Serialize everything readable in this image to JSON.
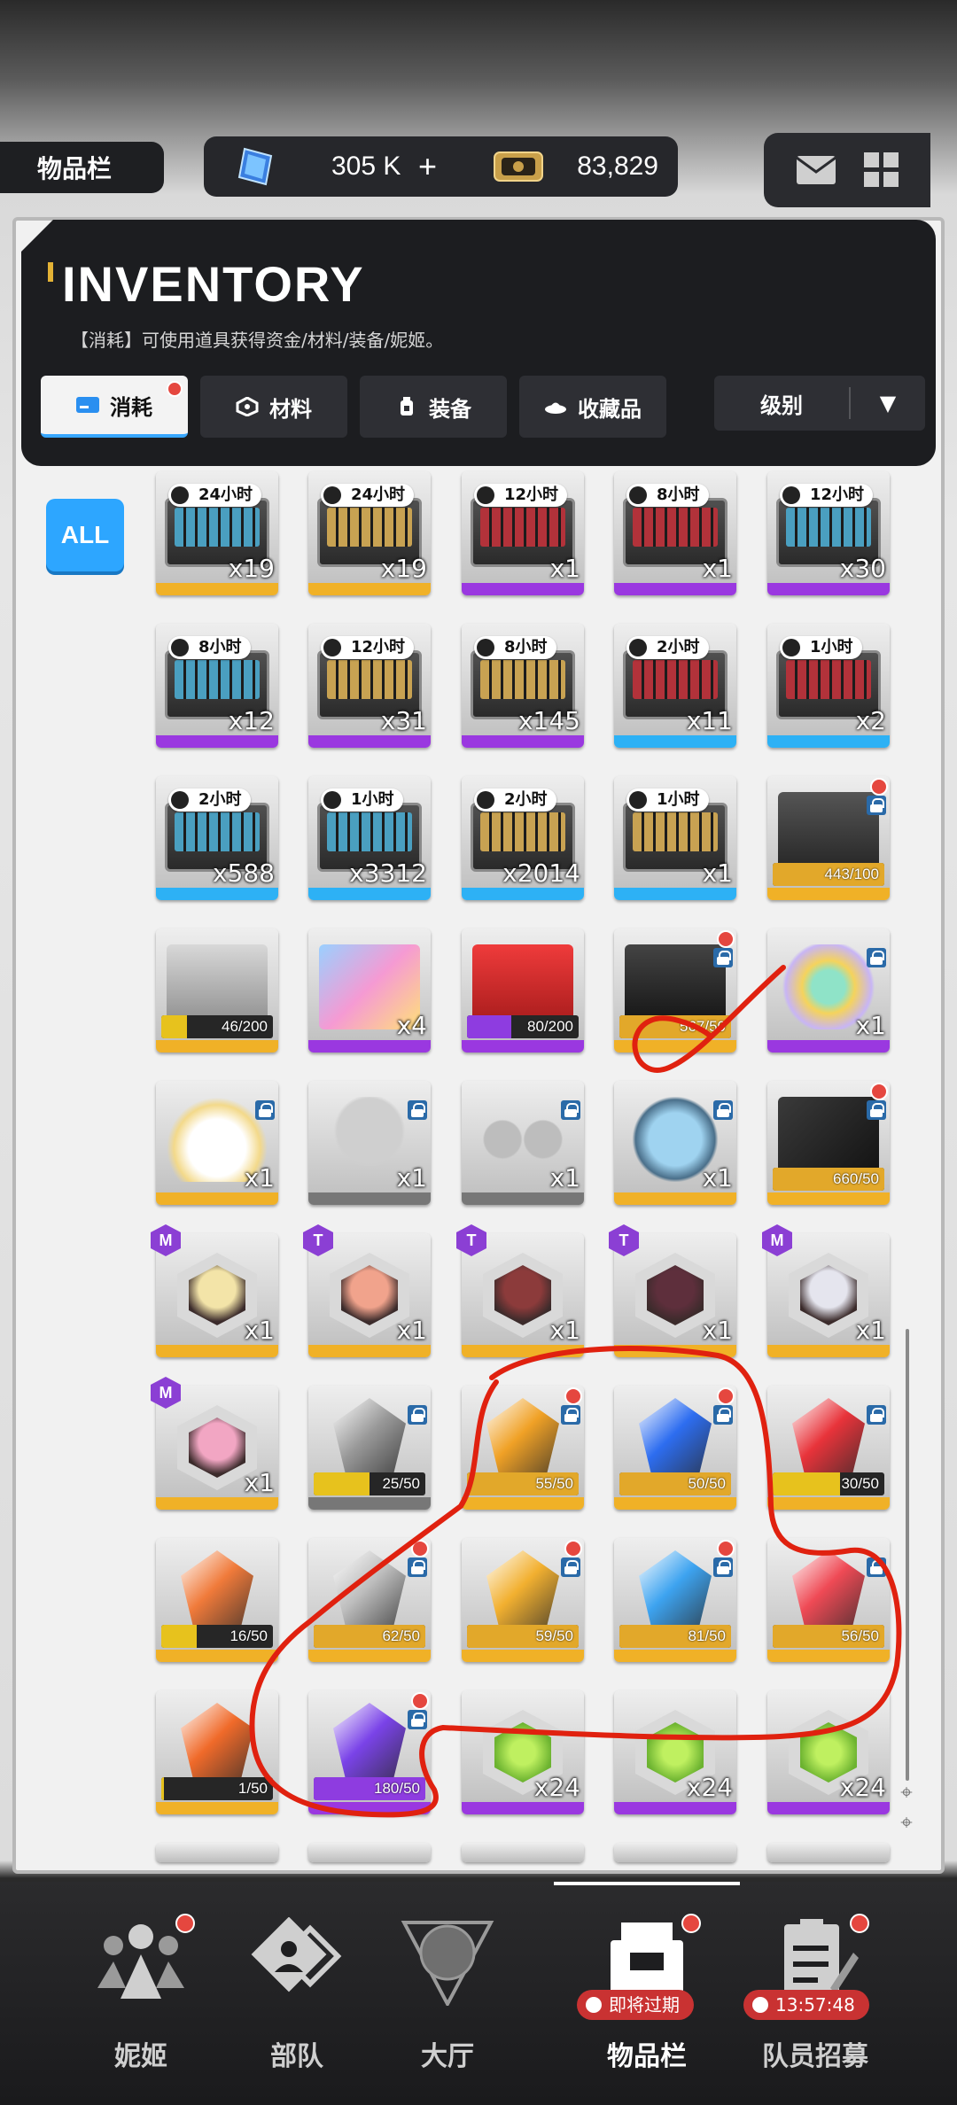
{
  "header": {
    "page_tag": "物品栏",
    "gems": "305 K",
    "gems_plus": "+",
    "credits": "83,829"
  },
  "panel": {
    "title": "INVENTORY",
    "subtitle": "【消耗】可使用道具获得资金/材料/装备/妮姬。",
    "tabs": [
      {
        "label": "消耗",
        "icon": "consumable-icon"
      },
      {
        "label": "材料",
        "icon": "material-icon"
      },
      {
        "label": "装备",
        "icon": "equipment-icon"
      },
      {
        "label": "收藏品",
        "icon": "collection-icon"
      }
    ],
    "sort_label": "级别",
    "sort_caret": "▼"
  },
  "filter_all": "ALL",
  "colors": {
    "gold": "#f0b127",
    "purple": "#9a38e0",
    "blue": "#2db1f5",
    "red_dot": "#e5473f",
    "annotation": "#e0210f"
  },
  "rows": [
    [
      {
        "timer": "24小时",
        "qty": "x19",
        "rarity": "gold",
        "liner": "#4a9fc0"
      },
      {
        "timer": "24小时",
        "qty": "x19",
        "rarity": "gold",
        "liner": "#c8a252"
      },
      {
        "timer": "12小时",
        "qty": "x1",
        "rarity": "purple",
        "liner": "#b2323a"
      },
      {
        "timer": "8小时",
        "qty": "x1",
        "rarity": "purple",
        "liner": "#b2323a"
      },
      {
        "timer": "12小时",
        "qty": "x30",
        "rarity": "purple",
        "liner": "#4a9fc0"
      }
    ],
    [
      {
        "timer": "8小时",
        "qty": "x12",
        "rarity": "purple",
        "liner": "#4a9fc0"
      },
      {
        "timer": "12小时",
        "qty": "x31",
        "rarity": "purple",
        "liner": "#c8a252"
      },
      {
        "timer": "8小时",
        "qty": "x145",
        "rarity": "purple",
        "liner": "#c8a252"
      },
      {
        "timer": "2小时",
        "qty": "x11",
        "rarity": "blue",
        "liner": "#b2323a"
      },
      {
        "timer": "1小时",
        "qty": "x2",
        "rarity": "blue",
        "liner": "#b2323a"
      }
    ],
    [
      {
        "timer": "2小时",
        "qty": "x588",
        "rarity": "blue",
        "liner": "#4a9fc0"
      },
      {
        "timer": "1小时",
        "qty": "x3312",
        "rarity": "blue",
        "liner": "#4a9fc0"
      },
      {
        "timer": "2小时",
        "qty": "x2014",
        "rarity": "blue",
        "liner": "#c8a252"
      },
      {
        "timer": "1小时",
        "qty": "x1",
        "rarity": "blue",
        "liner": "#c8a252"
      },
      {
        "bar": "443/100",
        "fill": 1.0,
        "fill_color": "#e2a82a",
        "lock": true,
        "dot": true,
        "rarity": "gold",
        "art": "chest-icon"
      }
    ],
    [
      {
        "bar": "46/200",
        "fill": 0.23,
        "fill_color": "#e7c21d",
        "rarity": "gold",
        "art": "crate-icon"
      },
      {
        "qty": "x4",
        "rarity": "purple",
        "art": "gift-box-icon"
      },
      {
        "bar": "80/200",
        "fill": 0.4,
        "fill_color": "#8e3ce0",
        "rarity": "purple",
        "art": "lucky-box-icon"
      },
      {
        "bar": "567/50",
        "fill": 1.0,
        "fill_color": "#e2a82a",
        "lock": true,
        "dot": true,
        "rarity": "gold",
        "art": "black-box-icon"
      },
      {
        "qty": "x1",
        "lock": true,
        "rarity": "purple",
        "art": "bouquet-icon"
      }
    ],
    [
      {
        "qty": "x1",
        "lock": true,
        "rarity": "gold",
        "art": "cake-icon"
      },
      {
        "qty": "x1",
        "lock": true,
        "rarity": "gray",
        "art": "briefs-icon"
      },
      {
        "qty": "x1",
        "lock": true,
        "rarity": "gray",
        "art": "bra-icon"
      },
      {
        "qty": "x1",
        "lock": true,
        "rarity": "gold",
        "art": "robot-head-icon"
      },
      {
        "bar": "660/50",
        "fill": 1.0,
        "fill_color": "#e2a82a",
        "lock": true,
        "dot": true,
        "rarity": "gold",
        "art": "dark-box-icon"
      }
    ],
    [
      {
        "qty": "x1",
        "badge": "M",
        "rarity": "gold",
        "face": "#f3e4a8"
      },
      {
        "qty": "x1",
        "badge": "T",
        "rarity": "gold",
        "face": "#f1a38c"
      },
      {
        "qty": "x1",
        "badge": "T",
        "rarity": "gold",
        "face": "#8c3b3b"
      },
      {
        "qty": "x1",
        "badge": "T",
        "rarity": "gold",
        "face": "#5e2f3c"
      },
      {
        "qty": "x1",
        "badge": "M",
        "rarity": "gold",
        "face": "#e5e5ee"
      }
    ],
    [
      {
        "qty": "x1",
        "badge": "M",
        "rarity": "gold",
        "face": "#f2a6c3"
      },
      {
        "bar": "25/50",
        "fill": 0.5,
        "fill_color": "#e7c21d",
        "lock": true,
        "rarity": "gray",
        "crystal": "#9a9a9a"
      },
      {
        "bar": "55/50",
        "fill": 1.0,
        "fill_color": "#e2a82a",
        "lock": true,
        "dot": true,
        "rarity": "gold",
        "crystal": "#f0a126"
      },
      {
        "bar": "50/50",
        "fill": 1.0,
        "fill_color": "#e2a82a",
        "lock": true,
        "dot": true,
        "rarity": "gold",
        "crystal": "#2d6df0"
      },
      {
        "bar": "30/50",
        "fill": 0.6,
        "fill_color": "#e7c21d",
        "lock": true,
        "rarity": "gold",
        "crystal": "#e8333a"
      }
    ],
    [
      {
        "bar": "16/50",
        "fill": 0.32,
        "fill_color": "#e7c21d",
        "rarity": "gold",
        "crystal": "#f07a3a"
      },
      {
        "bar": "62/50",
        "fill": 1.0,
        "fill_color": "#e2a82a",
        "lock": true,
        "dot": true,
        "rarity": "gold",
        "crystal": "#bdbdbd"
      },
      {
        "bar": "59/50",
        "fill": 1.0,
        "fill_color": "#e2a82a",
        "lock": true,
        "dot": true,
        "rarity": "gold",
        "crystal": "#f2b030"
      },
      {
        "bar": "81/50",
        "fill": 1.0,
        "fill_color": "#e2a82a",
        "lock": true,
        "dot": true,
        "rarity": "gold",
        "crystal": "#3da3f0"
      },
      {
        "bar": "56/50",
        "fill": 1.0,
        "fill_color": "#e2a82a",
        "lock": true,
        "rarity": "gold",
        "crystal": "#ef4a55"
      }
    ],
    [
      {
        "bar": "1/50",
        "fill": 0.02,
        "fill_color": "#e7c21d",
        "rarity": "gold",
        "crystal": "#f06a2a"
      },
      {
        "bar": "180/50",
        "fill": 1.0,
        "fill_color": "#8e3ce0",
        "lock": true,
        "dot": true,
        "rarity": "purple",
        "crystal": "#7a43e8"
      },
      {
        "qty": "x24",
        "rarity": "purple",
        "green_hex": true
      },
      {
        "qty": "x24",
        "rarity": "purple",
        "green_hex": true
      },
      {
        "qty": "x24",
        "rarity": "purple",
        "green_hex": true
      }
    ]
  ],
  "nav": [
    {
      "label": "妮姬",
      "icon": "nikke-icon",
      "dot": true
    },
    {
      "label": "部队",
      "icon": "squad-icon",
      "dot": false
    },
    {
      "label": "大厅",
      "icon": "lobby-icon",
      "dot": false
    },
    {
      "label": "物品栏",
      "icon": "inventory-icon",
      "dot": true,
      "active": true,
      "pill": "即将过期"
    },
    {
      "label": "队员招募",
      "icon": "recruit-icon",
      "dot": true,
      "pill": "13:57:48"
    }
  ]
}
